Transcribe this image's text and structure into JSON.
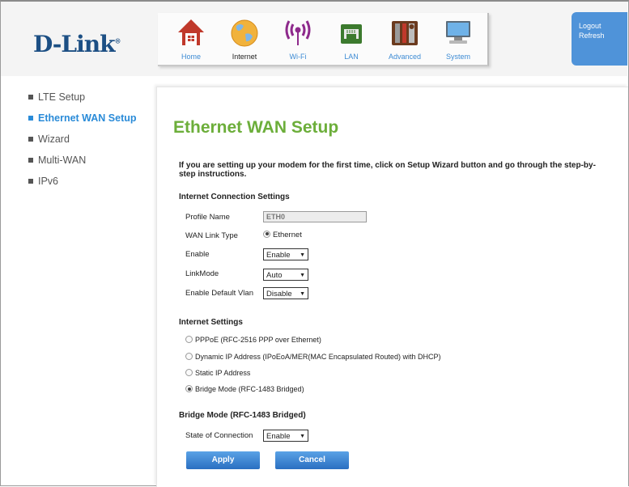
{
  "brand": {
    "name": "D-Link",
    "mark": "®"
  },
  "nav": {
    "items": [
      {
        "label": "Home",
        "icon": "home-icon"
      },
      {
        "label": "Internet",
        "icon": "globe-icon"
      },
      {
        "label": "Wi-Fi",
        "icon": "wifi-icon"
      },
      {
        "label": "LAN",
        "icon": "lan-port-icon"
      },
      {
        "label": "Advanced",
        "icon": "tools-icon"
      },
      {
        "label": "System",
        "icon": "computer-icon"
      }
    ],
    "active": "Internet"
  },
  "user_menu": {
    "logout": "Logout",
    "refresh": "Refresh"
  },
  "sidebar": {
    "items": [
      {
        "label": "LTE Setup"
      },
      {
        "label": "Ethernet WAN Setup",
        "active": true
      },
      {
        "label": "Wizard"
      },
      {
        "label": "Multi-WAN"
      },
      {
        "label": "IPv6"
      }
    ]
  },
  "page": {
    "title": "Ethernet WAN Setup",
    "intro": "If you are setting up your modem for the first time, click on Setup Wizard button and go through the step-by-step instructions."
  },
  "connection": {
    "heading": "Internet Connection Settings",
    "profile_label": "Profile Name",
    "profile_value": "ETH0",
    "wan_type_label": "WAN Link Type",
    "wan_type_value": "Ethernet",
    "enable_label": "Enable",
    "enable_value": "Enable",
    "linkmode_label": "LinkMode",
    "linkmode_value": "Auto",
    "vlan_label": "Enable Default Vlan",
    "vlan_value": "Disable"
  },
  "internet": {
    "heading": "Internet Settings",
    "options": [
      {
        "label": "PPPoE (RFC-2516 PPP over Ethernet)",
        "selected": false
      },
      {
        "label": "Dynamic IP Address (IPoEoA/MER(MAC Encapsulated Routed) with DHCP)",
        "selected": false
      },
      {
        "label": "Static IP Address",
        "selected": false
      },
      {
        "label": "Bridge Mode (RFC-1483 Bridged)",
        "selected": true
      }
    ]
  },
  "bridge": {
    "heading": "Bridge Mode (RFC-1483 Bridged)",
    "state_label": "State of Connection",
    "state_value": "Enable"
  },
  "buttons": {
    "apply": "Apply",
    "cancel": "Cancel"
  },
  "colors": {
    "brand_blue": "#1c4f84",
    "link_blue": "#2a8bd8",
    "title_green": "#6cae3a",
    "button_blue": "#3f86d3"
  }
}
